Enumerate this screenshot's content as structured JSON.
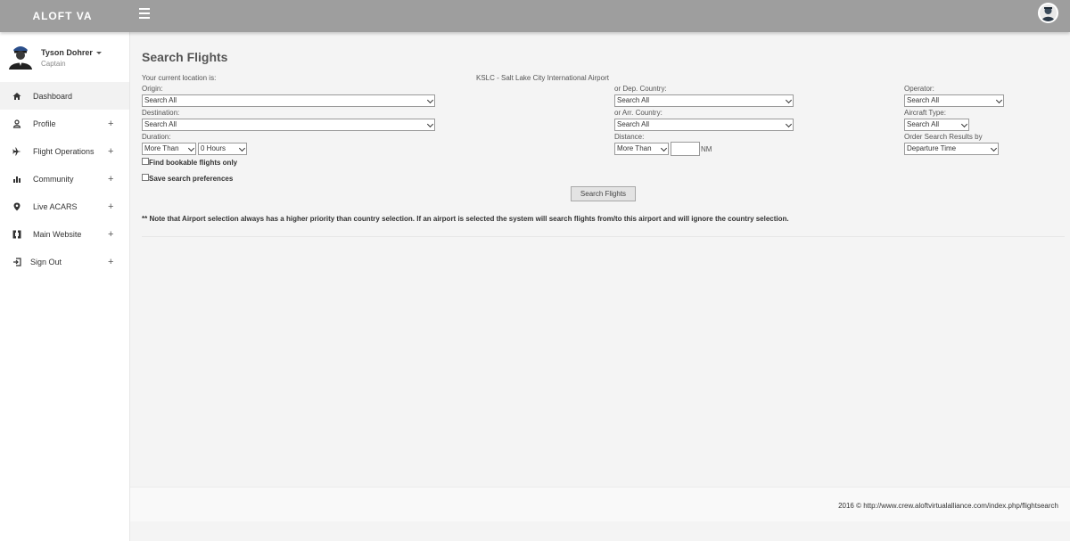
{
  "app": {
    "brand": "ALOFT VA"
  },
  "user": {
    "name": "Tyson Dohrer",
    "rank": "Captain"
  },
  "sidebar": {
    "items": [
      {
        "label": "Dashboard",
        "icon": "home-icon",
        "expandable": false,
        "active": true
      },
      {
        "label": "Profile",
        "icon": "user-icon",
        "expandable": true
      },
      {
        "label": "Flight Operations",
        "icon": "plane-icon",
        "expandable": true
      },
      {
        "label": "Community",
        "icon": "bar-chart-icon",
        "expandable": true
      },
      {
        "label": "Live ACARS",
        "icon": "map-marker-icon",
        "expandable": true
      },
      {
        "label": "Main Website",
        "icon": "grid-icon",
        "expandable": true
      },
      {
        "label": "Sign Out",
        "icon": "sign-out-icon",
        "expandable": true
      }
    ],
    "plus": "+"
  },
  "search": {
    "title": "Search Flights",
    "current_location_label": "Your current location is:",
    "current_location_value": "KSLC - Salt Lake City International Airport",
    "origin_label": "Origin:",
    "origin_value": "Search All",
    "destination_label": "Destination:",
    "destination_value": "Search All",
    "duration_label": "Duration:",
    "duration_compare": "More Than",
    "duration_hours": "0 Hours",
    "dep_country_label": "or Dep. Country:",
    "dep_country_value": "Search All",
    "arr_country_label": "or Arr. Country:",
    "arr_country_value": "Search All",
    "distance_label": "Distance:",
    "distance_compare": "More Than",
    "distance_value": "",
    "distance_unit": "NM",
    "operator_label": "Operator:",
    "operator_value": "Search All",
    "aircraft_label": "Aircraft Type:",
    "aircraft_value": "Search All",
    "order_label": "Order Search Results by",
    "order_value": "Departure Time",
    "bookable_label": "Find bookable flights only",
    "save_prefs_label": "Save search preferences",
    "submit_label": "Search Flights",
    "note": "** Note that Airport selection always has a higher priority than country selection. If an airport is selected the system will search flights from/to this airport and will ignore the country selection."
  },
  "footer": {
    "text": "2016 © http://www.crew.aloftvirtualalliance.com/index.php/flightsearch"
  }
}
